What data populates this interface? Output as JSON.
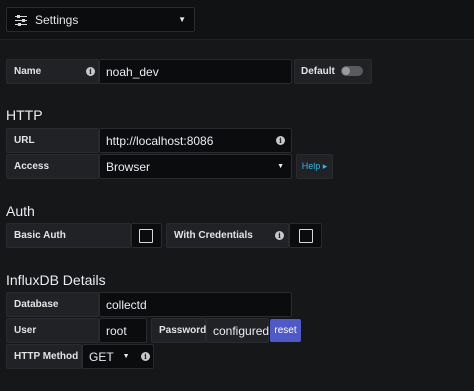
{
  "header": {
    "settings_label": "Settings"
  },
  "name_row": {
    "label": "Name",
    "value": "noah_dev",
    "default_label": "Default",
    "default_on": false
  },
  "http": {
    "title": "HTTP",
    "url_label": "URL",
    "url_value": "http://localhost:8086",
    "access_label": "Access",
    "access_value": "Browser",
    "help_label": "Help ▸"
  },
  "auth": {
    "title": "Auth",
    "basic_auth_label": "Basic Auth",
    "basic_auth_checked": false,
    "with_credentials_label": "With Credentials",
    "with_credentials_checked": false
  },
  "influx": {
    "title": "InfluxDB Details",
    "database_label": "Database",
    "database_value": "collectd",
    "user_label": "User",
    "user_value": "root",
    "password_label": "Password",
    "password_value": "configured",
    "reset_label": "reset",
    "method_label": "HTTP Method",
    "method_value": "GET"
  },
  "colors": {
    "background": "#161719",
    "input": "#0b0c0e",
    "label": "#202226",
    "accent": "#4f59c8",
    "link": "#33b5e5"
  }
}
